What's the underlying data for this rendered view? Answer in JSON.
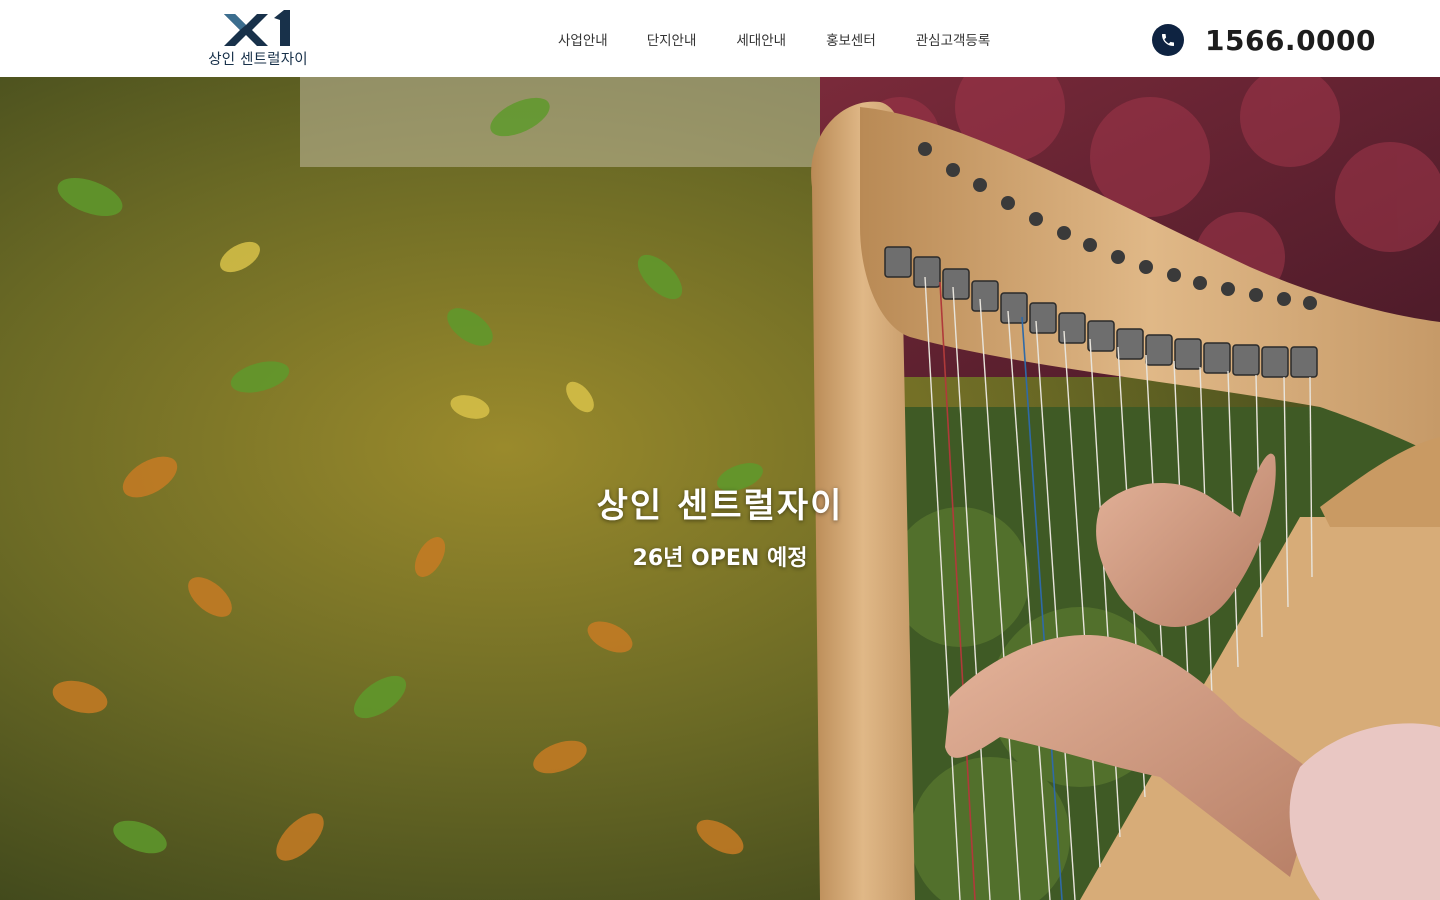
{
  "header": {
    "logo": {
      "mark": "XI",
      "name": "상인 센트럴자이"
    },
    "nav": [
      "사업안내",
      "단지안내",
      "세대안내",
      "홍보센터",
      "관심고객등록"
    ],
    "phone": {
      "icon": "phone-icon",
      "number": "1566.0000"
    }
  },
  "hero": {
    "title": "상인 센트럴자이",
    "subtitle": "26년 OPEN 예정",
    "image": "harp-player-in-garden"
  },
  "colors": {
    "brand_navy": "#0e2341",
    "logo_text": "#18314a",
    "nav_text": "#333333"
  }
}
